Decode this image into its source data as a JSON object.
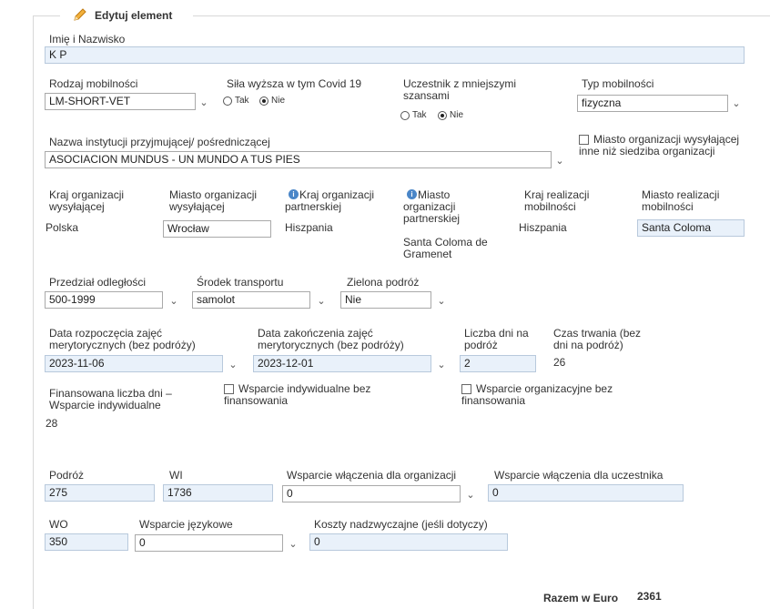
{
  "form": {
    "title": "Edytuj element",
    "full_name_label": "Imię i Nazwisko",
    "full_name_value": "K        P",
    "mobility_type_label": "Rodzaj mobilności",
    "mobility_type_value": "LM-SHORT-VET",
    "force_majeure_label": "Siła wyższa w tym Covid 19",
    "fewer_opportunities_label": "Uczestnik z mniejszymi szansami",
    "yes_label": "Tak",
    "no_label": "Nie",
    "mobility_kind_label": "Typ mobilności",
    "mobility_kind_value": "fizyczna",
    "host_institution_label": "Nazwa instytucji przyjmującej/ pośredniczącej",
    "host_institution_value": "ASOCIACION MUNDUS - UN MUNDO A TUS PIES",
    "city_other_label": "Miasto organizacji wysyłającej inne niż siedziba organizacji",
    "sending_country_label": "Kraj organizacji wysyłającej",
    "sending_country_value": "Polska",
    "sending_city_label": "Miasto organizacji wysyłającej",
    "sending_city_value": "Wrocław",
    "partner_country_label": "Kraj organizacji partnerskiej",
    "partner_country_value": "Hiszpania",
    "partner_city_label": "Miasto organizacji partnerskiej",
    "partner_city_value": "Santa Coloma de Gramenet",
    "mobility_country_label": "Kraj realizacji mobilności",
    "mobility_country_value": "Hiszpania",
    "mobility_city_label": "Miasto realizacji mobilności",
    "mobility_city_value": "Santa Coloma",
    "distance_label": "Przedział odległości",
    "distance_value": "500-1999",
    "transport_label": "Środek transportu",
    "transport_value": "samolot",
    "green_travel_label": "Zielona podróż",
    "green_travel_value": "Nie",
    "start_date_label": "Data rozpoczęcia zajęć merytorycznych (bez podróży)",
    "start_date_value": "2023-11-06",
    "end_date_label": "Data zakończenia zajęć merytorycznych (bez podróży)",
    "end_date_value": "2023-12-01",
    "travel_days_label": "Liczba dni na podróż",
    "travel_days_value": "2",
    "duration_label": "Czas trwania (bez dni na podróż)",
    "duration_value": "26",
    "funded_days_label": "Finansowana liczba dni – Wsparcie indywidualne",
    "funded_days_value": "28",
    "individual_no_funding_label": "Wsparcie indywidualne bez finansowania",
    "org_no_funding_label": "Wsparcie organizacyjne bez finansowania",
    "travel_label": "Podróż",
    "travel_value": "275",
    "wi_label": "WI",
    "wi_value": "1736",
    "inclusion_org_label": "Wsparcie włączenia dla organizacji",
    "inclusion_org_value": "0",
    "inclusion_participant_label": "Wsparcie włączenia dla uczestnika",
    "inclusion_participant_value": "0",
    "wo_label": "WO",
    "wo_value": "350",
    "language_support_label": "Wsparcie językowe",
    "language_support_value": "0",
    "exceptional_costs_label": "Koszty nadzwyczajne (jeśli dotyczy)",
    "exceptional_costs_value": "0",
    "total_label": "Razem w Euro",
    "total_value": "2361"
  },
  "icons": {
    "title_icon": "pencil-icon",
    "dropdown": "chevron-down-icon",
    "info": "info-icon"
  },
  "colors": {
    "input_bg": "#e9f1fa",
    "input_border": "#b8c9dc",
    "info_icon": "#4a86c8",
    "pencil": "#e8a43a"
  }
}
